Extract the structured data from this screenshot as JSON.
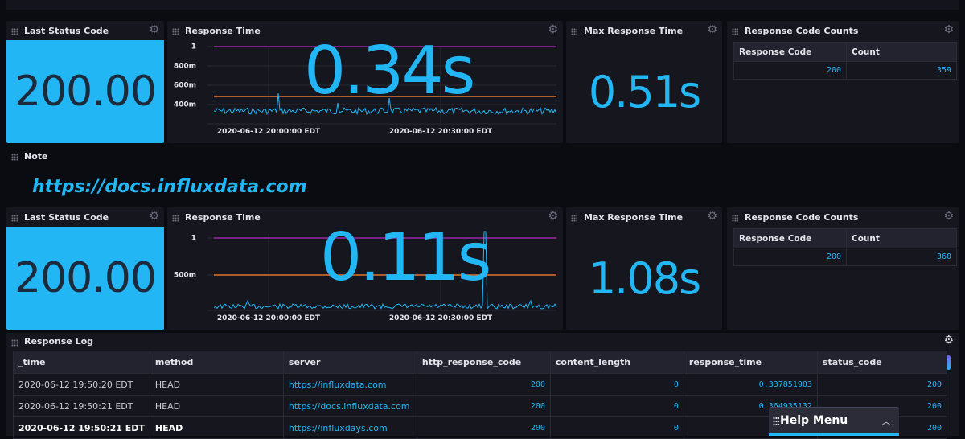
{
  "row1": {
    "last_status": {
      "title": "Last Status Code",
      "value": "200.00"
    },
    "response_time": {
      "title": "Response Time",
      "value": "0.34s",
      "y_ticks": [
        "1",
        "800m",
        "600m",
        "400m"
      ],
      "x_ticks": [
        "2020-06-12 20:00:00 EDT",
        "2020-06-12 20:30:00 EDT"
      ]
    },
    "max_response": {
      "title": "Max Response Time",
      "value": "0.51s"
    },
    "code_counts": {
      "title": "Response Code Counts",
      "headers": [
        "Response Code",
        "Count"
      ],
      "rows": [
        [
          "200",
          "359"
        ]
      ]
    }
  },
  "note": {
    "title": "Note",
    "link": "https://docs.influxdata.com"
  },
  "row2": {
    "last_status": {
      "title": "Last Status Code",
      "value": "200.00"
    },
    "response_time": {
      "title": "Response Time",
      "value": "0.11s",
      "y_ticks": [
        "1",
        "500m"
      ],
      "x_ticks": [
        "2020-06-12 20:00:00 EDT",
        "2020-06-12 20:30:00 EDT"
      ]
    },
    "max_response": {
      "title": "Max Response Time",
      "value": "1.08s"
    },
    "code_counts": {
      "title": "Response Code Counts",
      "headers": [
        "Response Code",
        "Count"
      ],
      "rows": [
        [
          "200",
          "360"
        ]
      ]
    }
  },
  "log": {
    "title": "Response Log",
    "headers": [
      "_time",
      "method",
      "server",
      "http_response_code",
      "content_length",
      "response_time",
      "status_code"
    ],
    "rows": [
      [
        "2020-06-12 19:50:20 EDT",
        "HEAD",
        "https://influxdata.com",
        "200",
        "0",
        "0.337851903",
        "200"
      ],
      [
        "2020-06-12 19:50:21 EDT",
        "HEAD",
        "https://docs.influxdata.com",
        "200",
        "0",
        "0.364935132",
        "200"
      ],
      [
        "2020-06-12 19:50:21 EDT",
        "HEAD",
        "https://influxdays.com",
        "200",
        "0",
        "0.",
        "200"
      ]
    ]
  },
  "help": {
    "label": "Help Menu"
  },
  "colors": {
    "accent": "#22b7f4",
    "threshold_high": "#9b2aa8",
    "threshold_mid": "#e0742b",
    "cell_bg": "#16161f"
  },
  "icons": {
    "gear": "gear-icon",
    "drag": "drag-handle-icon",
    "chevron": "chevron-up-icon"
  }
}
